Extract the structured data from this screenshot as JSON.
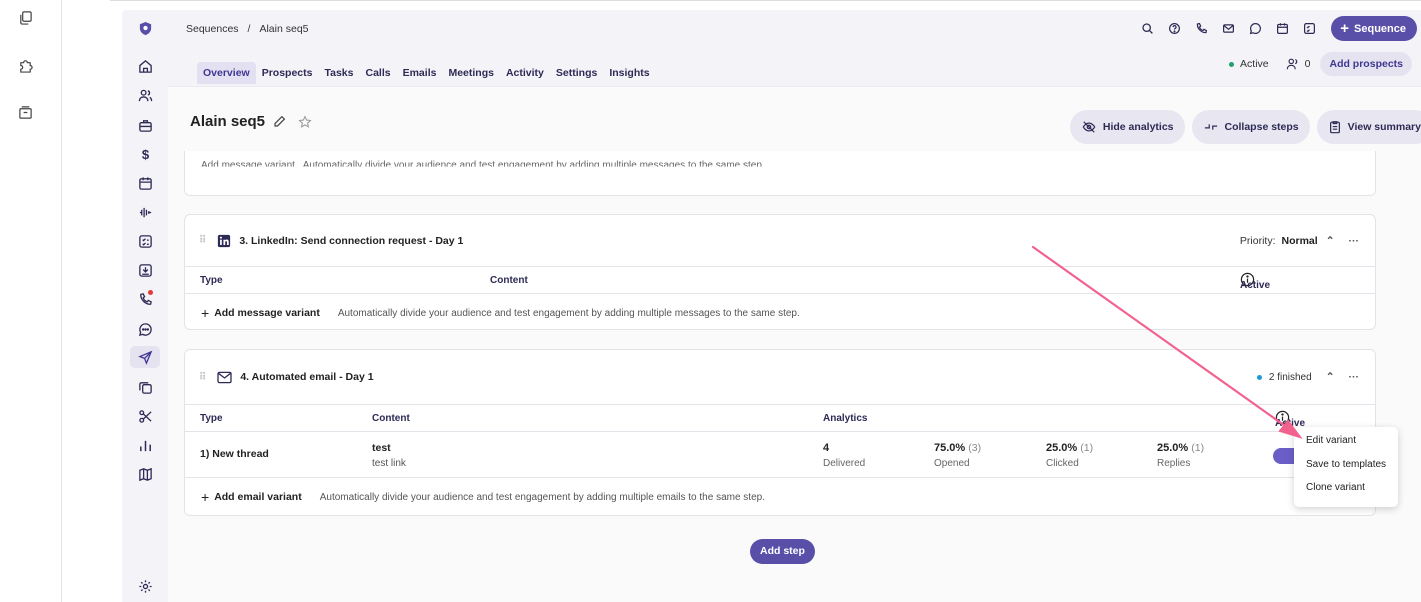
{
  "breadcrumb": {
    "root": "Sequences",
    "sep": "/",
    "current": "Alain seq5"
  },
  "header": {
    "sequence_button": "Sequence"
  },
  "tabs": [
    "Overview",
    "Prospects",
    "Tasks",
    "Calls",
    "Emails",
    "Meetings",
    "Activity",
    "Settings",
    "Insights"
  ],
  "status": {
    "label": "Active",
    "prospect_count": "0",
    "add_prospects": "Add prospects"
  },
  "title": "Alain seq5",
  "actions": {
    "hide_analytics": "Hide analytics",
    "collapse_steps": "Collapse steps",
    "view_summary": "View summary"
  },
  "partial_card": {
    "text": "Add message variant   Automatically divide your audience and test engagement by adding multiple messages to the same step."
  },
  "step3": {
    "title": "3. LinkedIn: Send connection request - Day 1",
    "priority_label": "Priority:",
    "priority_value": "Normal",
    "col_type": "Type",
    "col_content": "Content",
    "col_active": "Active",
    "add_label": "Add message variant",
    "add_desc": "Automatically divide your audience and test engagement by adding multiple messages to the same step."
  },
  "step4": {
    "title": "4. Automated email - Day 1",
    "status": "2 finished",
    "col_type": "Type",
    "col_content": "Content",
    "col_analytics": "Analytics",
    "col_active": "Active",
    "row": {
      "type": "1) New thread",
      "subject": "test",
      "body": "test link",
      "delivered": "4",
      "delivered_label": "Delivered",
      "opened": "75.0%",
      "opened_count": "(3)",
      "opened_label": "Opened",
      "clicked": "25.0%",
      "clicked_count": "(1)",
      "clicked_label": "Clicked",
      "replies": "25.0%",
      "replies_count": "(1)",
      "replies_label": "Replies"
    },
    "add_label": "Add email variant",
    "add_desc": "Automatically divide your audience and test engagement by adding multiple emails to the same step."
  },
  "add_step": "Add step",
  "menu": [
    "Edit variant",
    "Save to templates",
    "Clone variant"
  ],
  "colors": {
    "brand": "#5a4fa8",
    "active_dot": "#22a06b",
    "finished_dot": "#1e9bd7",
    "annotation_arrow": "#f2628f"
  }
}
